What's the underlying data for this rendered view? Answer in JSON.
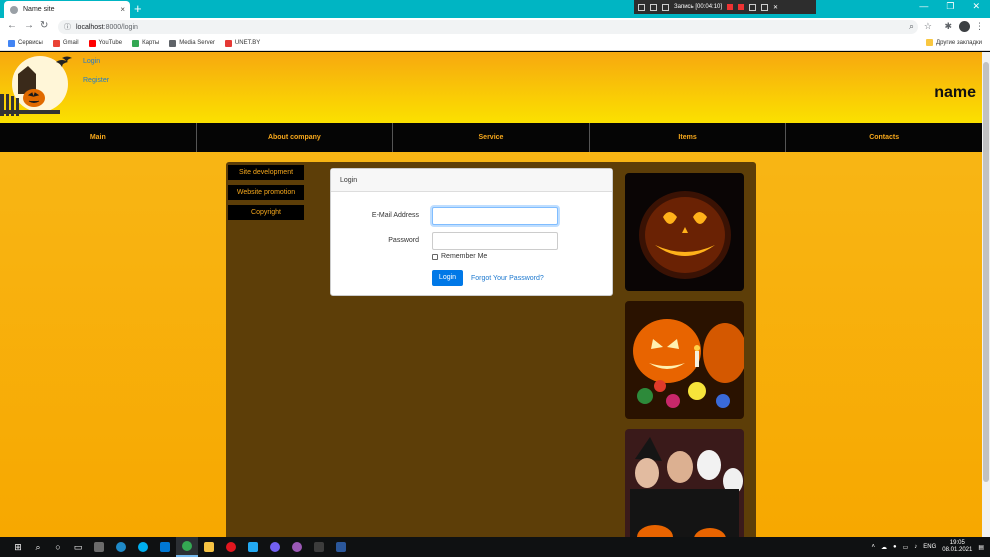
{
  "browser": {
    "tab_title": "Name site",
    "tab_close": "×",
    "new_tab": "+",
    "url_host": "localhost",
    "url_path": ":8000/login",
    "recording_label": "Запись [00:04:10]",
    "bookmarks": [
      {
        "label": "Сервисы",
        "color": "#4285f4"
      },
      {
        "label": "Gmail",
        "color": "#ea4335"
      },
      {
        "label": "YouTube",
        "color": "#ff0000"
      },
      {
        "label": "Карты",
        "color": "#34a853"
      },
      {
        "label": "Media Server",
        "color": "#5f6368"
      },
      {
        "label": "UNET.BY",
        "color": "#e53935"
      }
    ],
    "other_bookmarks": "Другие закладки"
  },
  "site": {
    "name": "name",
    "login_link": "Login",
    "register_link": "Register",
    "nav": [
      "Main",
      "About company",
      "Service",
      "Items",
      "Contacts"
    ],
    "sidebar": [
      "Site development",
      "Website promotion",
      "Copyright"
    ],
    "accent_color": "#f7a81c"
  },
  "login_form": {
    "header": "Login",
    "email_label": "E-Mail Address",
    "password_label": "Password",
    "remember_label": "Remember Me",
    "submit_label": "Login",
    "forgot_label": "Forgot Your Password?"
  },
  "taskbar": {
    "lang": "ENG",
    "time": "19:05",
    "date": "08.01.2021"
  }
}
